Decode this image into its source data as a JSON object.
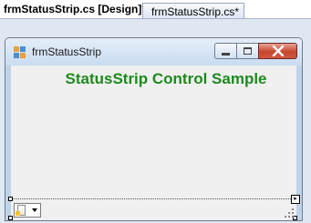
{
  "tabs": [
    {
      "label": "frmStatusStrip.cs [Design]*",
      "active": true
    },
    {
      "label": "frmStatusStrip.cs*",
      "active": false
    }
  ],
  "window": {
    "title": "frmStatusStrip",
    "icon": "form-icon",
    "caption_buttons": [
      "minimize-icon",
      "maximize-icon",
      "close-icon"
    ]
  },
  "form": {
    "heading": "StatusStrip Control Sample",
    "heading_color": "#1e8a1e"
  },
  "status_strip": {
    "dropdown_icon": "document-icon",
    "grip_icon": "size-grip-icon",
    "smart_tag_icon": "smart-tag-arrow-icon"
  }
}
